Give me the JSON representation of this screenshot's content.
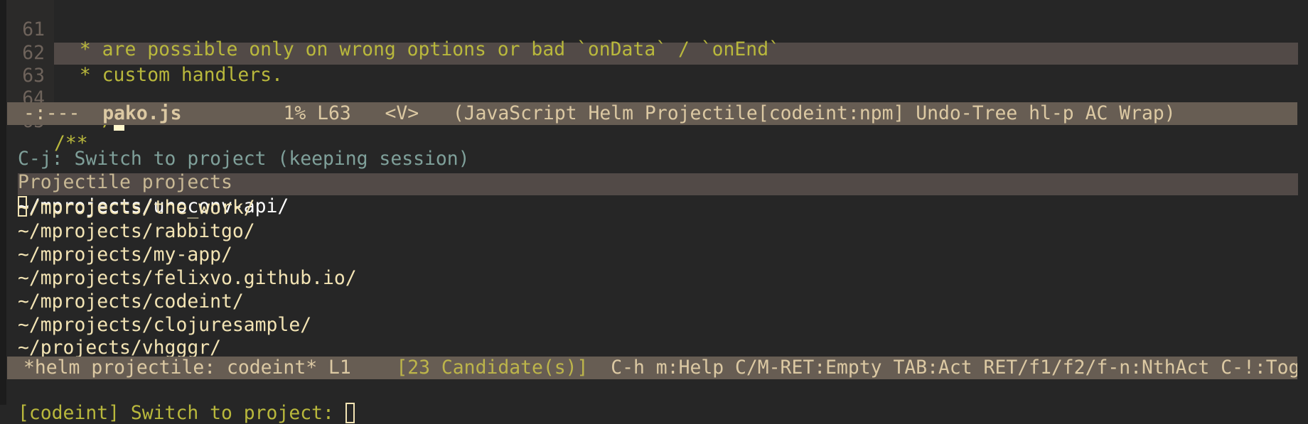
{
  "editor": {
    "lines": [
      {
        "num": "61",
        "text": " * are possible only on wrong options or bad `onData` / `onEnd`"
      },
      {
        "num": "62",
        "text": " * custom handlers."
      },
      {
        "num": "63",
        "text": " **/"
      },
      {
        "num": "64",
        "text": ""
      },
      {
        "num": "65",
        "text": "/**"
      }
    ],
    "current_line": 63
  },
  "modeline": {
    "status": "-:---",
    "buffer": "pako.js",
    "position": "1% L63",
    "state": "<V>",
    "modes": "(JavaScript Helm Projectile[codeint:npm] Undo-Tree hl-p AC Wrap)"
  },
  "helm": {
    "hint": "C-j: Switch to project (keeping session)",
    "source_header": "Projectile projects",
    "candidates": [
      "~/mprojects/unoconv-api/",
      "~/mprojects/the_work/",
      "~/mprojects/rabbitgo/",
      "~/mprojects/my-app/",
      "~/mprojects/felixvo.github.io/",
      "~/mprojects/codeint/",
      "~/mprojects/clojuresample/",
      "~/projects/vhgggr/"
    ],
    "selected_index": 0,
    "modeline": {
      "buffer": "*helm projectile: codeint*",
      "line": "L1",
      "count": "[23 Candidate(s)]",
      "keys": "C-h m:Help C/M-RET:Empty TAB:Act RET/f1/f2/f-n:NthAct C-!:Tog"
    },
    "prompt": "[codeint] Switch to project:",
    "input": ""
  },
  "colors": {
    "background": "#262626",
    "modeline": "#675d53",
    "highlight": "#524a47",
    "comment": "#b9b83c",
    "candidate": "#f3e4b4"
  }
}
